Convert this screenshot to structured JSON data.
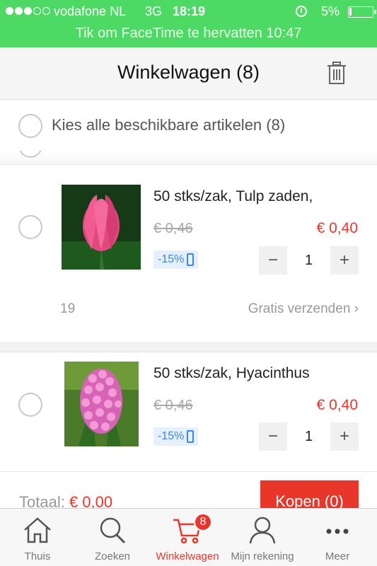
{
  "status_bar": {
    "carrier": "vodafone NL",
    "network": "3G",
    "time": "18:19",
    "battery": "5%",
    "facetime_banner": "Tik om FaceTime te hervatten 10:47"
  },
  "header": {
    "title": "Winkelwagen (8)",
    "trash_icon": "trash-icon"
  },
  "select_all": {
    "label": "Kies alle beschikbare artikelen (8)"
  },
  "items": [
    {
      "title": "50 stks/zak, Tulp zaden,",
      "old_price": "€ 0,46",
      "new_price": "€ 0,40",
      "discount": "-15%",
      "quantity": "1",
      "shop_count": "19",
      "shipping": "Gratis verzenden",
      "image_subject": "pink tulip"
    },
    {
      "title": "50 stks/zak, Hyacinthus",
      "old_price": "€ 0,46",
      "new_price": "€ 0,40",
      "discount": "-15%",
      "quantity": "1",
      "image_subject": "pink hyacinth"
    }
  ],
  "stepper": {
    "minus": "−",
    "plus": "+"
  },
  "footer": {
    "total_label": "Totaal:",
    "total_value": "€ 0,00",
    "buy_label": "Kopen (0)"
  },
  "tabs": [
    {
      "label": "Thuis",
      "icon": "home-icon",
      "active": false
    },
    {
      "label": "Zoeken",
      "icon": "search-icon",
      "active": false
    },
    {
      "label": "Winkelwagen",
      "icon": "cart-icon",
      "active": true,
      "badge": "8"
    },
    {
      "label": "Mijn rekening",
      "icon": "user-icon",
      "active": false
    },
    {
      "label": "Meer",
      "icon": "more-icon",
      "active": false
    }
  ],
  "colors": {
    "status_green": "#4cd964",
    "accent_red": "#e8362b",
    "discount_blue": "#3f86d8"
  }
}
